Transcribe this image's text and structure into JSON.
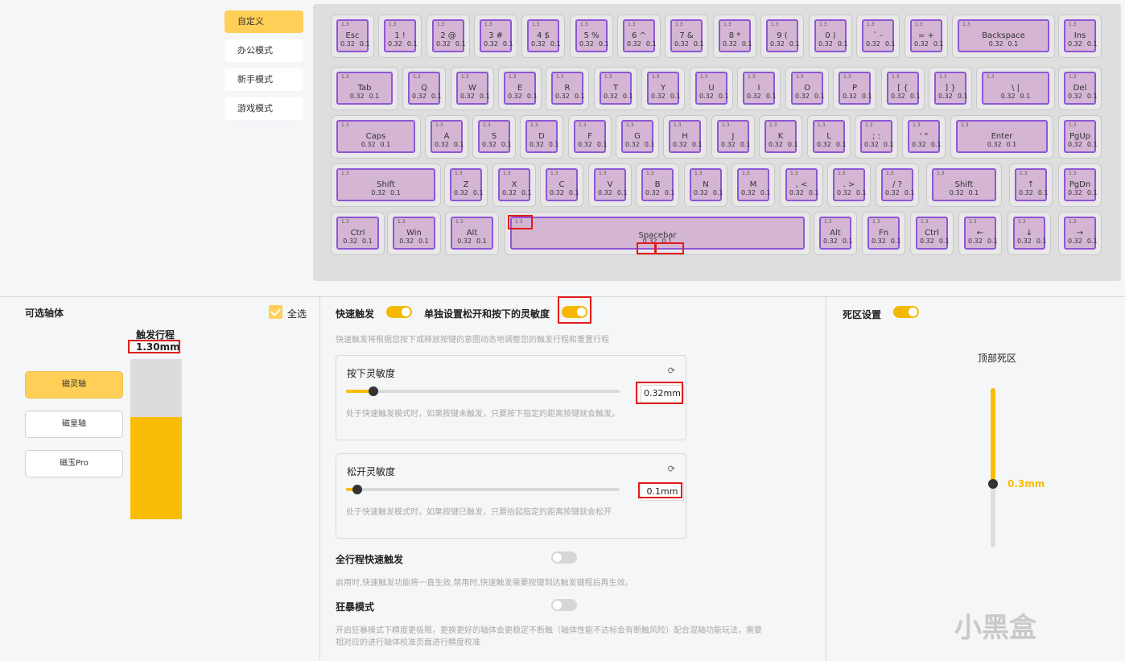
{
  "modes": [
    {
      "label": "自定义",
      "active": true
    },
    {
      "label": "办公模式",
      "active": false
    },
    {
      "label": "新手模式",
      "active": false
    },
    {
      "label": "游戏模式",
      "active": false
    }
  ],
  "keyboard": {
    "key_title": "1.3",
    "press": "0.32",
    "release": "0.1",
    "rows": [
      [
        "Esc",
        "1 !",
        "2 @",
        "3 #",
        "4 $",
        "5 %",
        "6 ^",
        "7 &",
        "8 *",
        "9 (",
        "0 )",
        "` -",
        "= +",
        "Backspace",
        "Ins"
      ],
      [
        "Tab",
        "Q",
        "W",
        "E",
        "R",
        "T",
        "Y",
        "U",
        "I",
        "O",
        "P",
        "[ {",
        "] }",
        "\\ |",
        "Del"
      ],
      [
        "Caps",
        "A",
        "S",
        "D",
        "F",
        "G",
        "H",
        "J",
        "K",
        "L",
        "; :",
        "' \"",
        "Enter",
        "PgUp"
      ],
      [
        "Shift",
        "Z",
        "X",
        "C",
        "V",
        "B",
        "N",
        "M",
        ", <",
        ". >",
        "/ ?",
        "Shift",
        "↑",
        "PgDn"
      ],
      [
        "Ctrl",
        "Win",
        "Alt",
        "Spacebar",
        "Alt",
        "Fn",
        "Ctrl",
        "←",
        "↓",
        "→"
      ]
    ]
  },
  "switches": {
    "title": "可选轴体",
    "select_all": "全选",
    "items": [
      {
        "label": "磁灵轴",
        "active": true
      },
      {
        "label": "磁皇轴",
        "active": false
      },
      {
        "label": "磁玉Pro",
        "active": false
      }
    ],
    "travel_title": "触发行程",
    "travel_value": "1.30mm",
    "travel_fill": 0.64
  },
  "rapid": {
    "title": "快速触发",
    "separate_label": "单独设置松开和按下的灵敏度",
    "desc": "快速触发将根据您按下或释放按键的意图动态地调整您的触发行程和重置行程",
    "press_card": {
      "title": "按下灵敏度",
      "value": "0.32mm",
      "fraction": 0.1,
      "desc": "处于快速触发模式时，如果按键未触发，只要按下指定的距离按键就会触发。"
    },
    "release_card": {
      "title": "松开灵敏度",
      "value": "0.1mm",
      "fraction": 0.04,
      "desc": "处于快速触发模式时，如果按键已触发，只要抬起指定的距离按键就会松开"
    },
    "full_travel": {
      "label": "全行程快速触发",
      "desc": "启用时,快速触发功能将一直生效,禁用时,快速触发需要按键到达触发键程后再生效。",
      "on": false
    },
    "rage": {
      "label": "狂暴模式",
      "desc1": "开启狂暴模式下精度更极限，更换更好的轴体会更稳定不断触（轴体性能不达标会有断触风险）配合混轴功能玩法，需要",
      "desc2": "相对应的进行轴体校准页面进行精度校准",
      "on": false
    }
  },
  "deadzone": {
    "title": "死区设置",
    "top_label": "顶部死区",
    "value": "0.3mm",
    "fraction": 0.6
  },
  "watermark": "小黑盒",
  "colors": {
    "accent": "#fbbc05",
    "key_face": "#d4b5d3",
    "key_border": "#8f56d6",
    "highlight": "#e01b1b"
  }
}
